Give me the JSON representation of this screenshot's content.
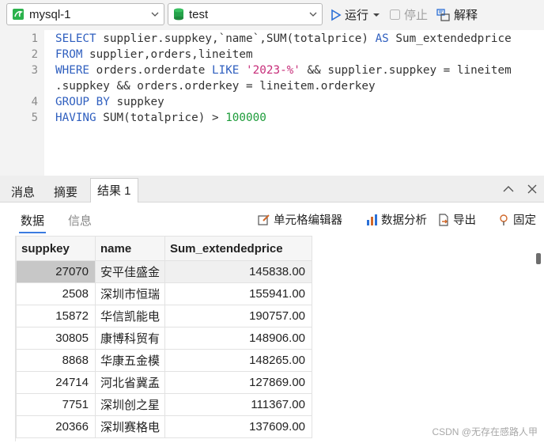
{
  "toolbar": {
    "connection": "mysql-1",
    "database": "test",
    "run_label": "运行",
    "stop_label": "停止",
    "explain_label": "解释"
  },
  "editor": {
    "line_numbers": [
      "1",
      "2",
      "",
      "3",
      "",
      "4",
      "5"
    ],
    "lines": [
      [
        {
          "t": "SELECT",
          "k": "kw"
        },
        {
          "t": " supplier.suppkey,`name`,SUM(totalprice) ",
          "k": ""
        },
        {
          "t": "AS",
          "k": "kw"
        },
        {
          "t": " Sum_extendedprice",
          "k": ""
        }
      ],
      [
        {
          "t": "FROM",
          "k": "kw"
        },
        {
          "t": " supplier,orders,lineitem",
          "k": ""
        }
      ],
      [
        {
          "t": "WHERE",
          "k": "kw"
        },
        {
          "t": " orders.orderdate ",
          "k": ""
        },
        {
          "t": "LIKE",
          "k": "kw"
        },
        {
          "t": " ",
          "k": ""
        },
        {
          "t": "'2023-%'",
          "k": "str"
        },
        {
          "t": " && supplier.suppkey = lineitem",
          "k": ""
        }
      ],
      [
        {
          "t": ".suppkey && orders.orderkey = lineitem.orderkey",
          "k": ""
        }
      ],
      [
        {
          "t": "GROUP BY",
          "k": "kw"
        },
        {
          "t": " suppkey",
          "k": ""
        }
      ],
      [
        {
          "t": "HAVING",
          "k": "kw"
        },
        {
          "t": " SUM(totalprice) > ",
          "k": ""
        },
        {
          "t": "100000",
          "k": "num"
        }
      ]
    ]
  },
  "result_tabs": [
    "消息",
    "摘要",
    "结果 1"
  ],
  "sub_toolbar": {
    "data_tab": "数据",
    "info_tab": "信息",
    "cell_editor": "单元格编辑器",
    "data_analysis": "数据分析",
    "export": "导出",
    "pin": "固定"
  },
  "table": {
    "columns": [
      "suppkey",
      "name",
      "Sum_extendedprice"
    ],
    "rows": [
      [
        "27070",
        "安平佳盛金",
        "145838.00"
      ],
      [
        "2508",
        "深圳市恒瑞",
        "155941.00"
      ],
      [
        "15872",
        "华信凯能电",
        "190757.00"
      ],
      [
        "30805",
        "康博科贸有",
        "148906.00"
      ],
      [
        "8868",
        "华康五金模",
        "148265.00"
      ],
      [
        "24714",
        "河北省冀孟",
        "127869.00"
      ],
      [
        "7751",
        "深圳创之星",
        "111367.00"
      ],
      [
        "20366",
        "深圳赛格电",
        "137609.00"
      ]
    ]
  },
  "watermark": "CSDN @无存在感路人甲",
  "colors": {
    "keyword": "#2f5fbf",
    "string": "#c72e7a",
    "number": "#1d9c3a",
    "accent": "#3a7be0"
  }
}
